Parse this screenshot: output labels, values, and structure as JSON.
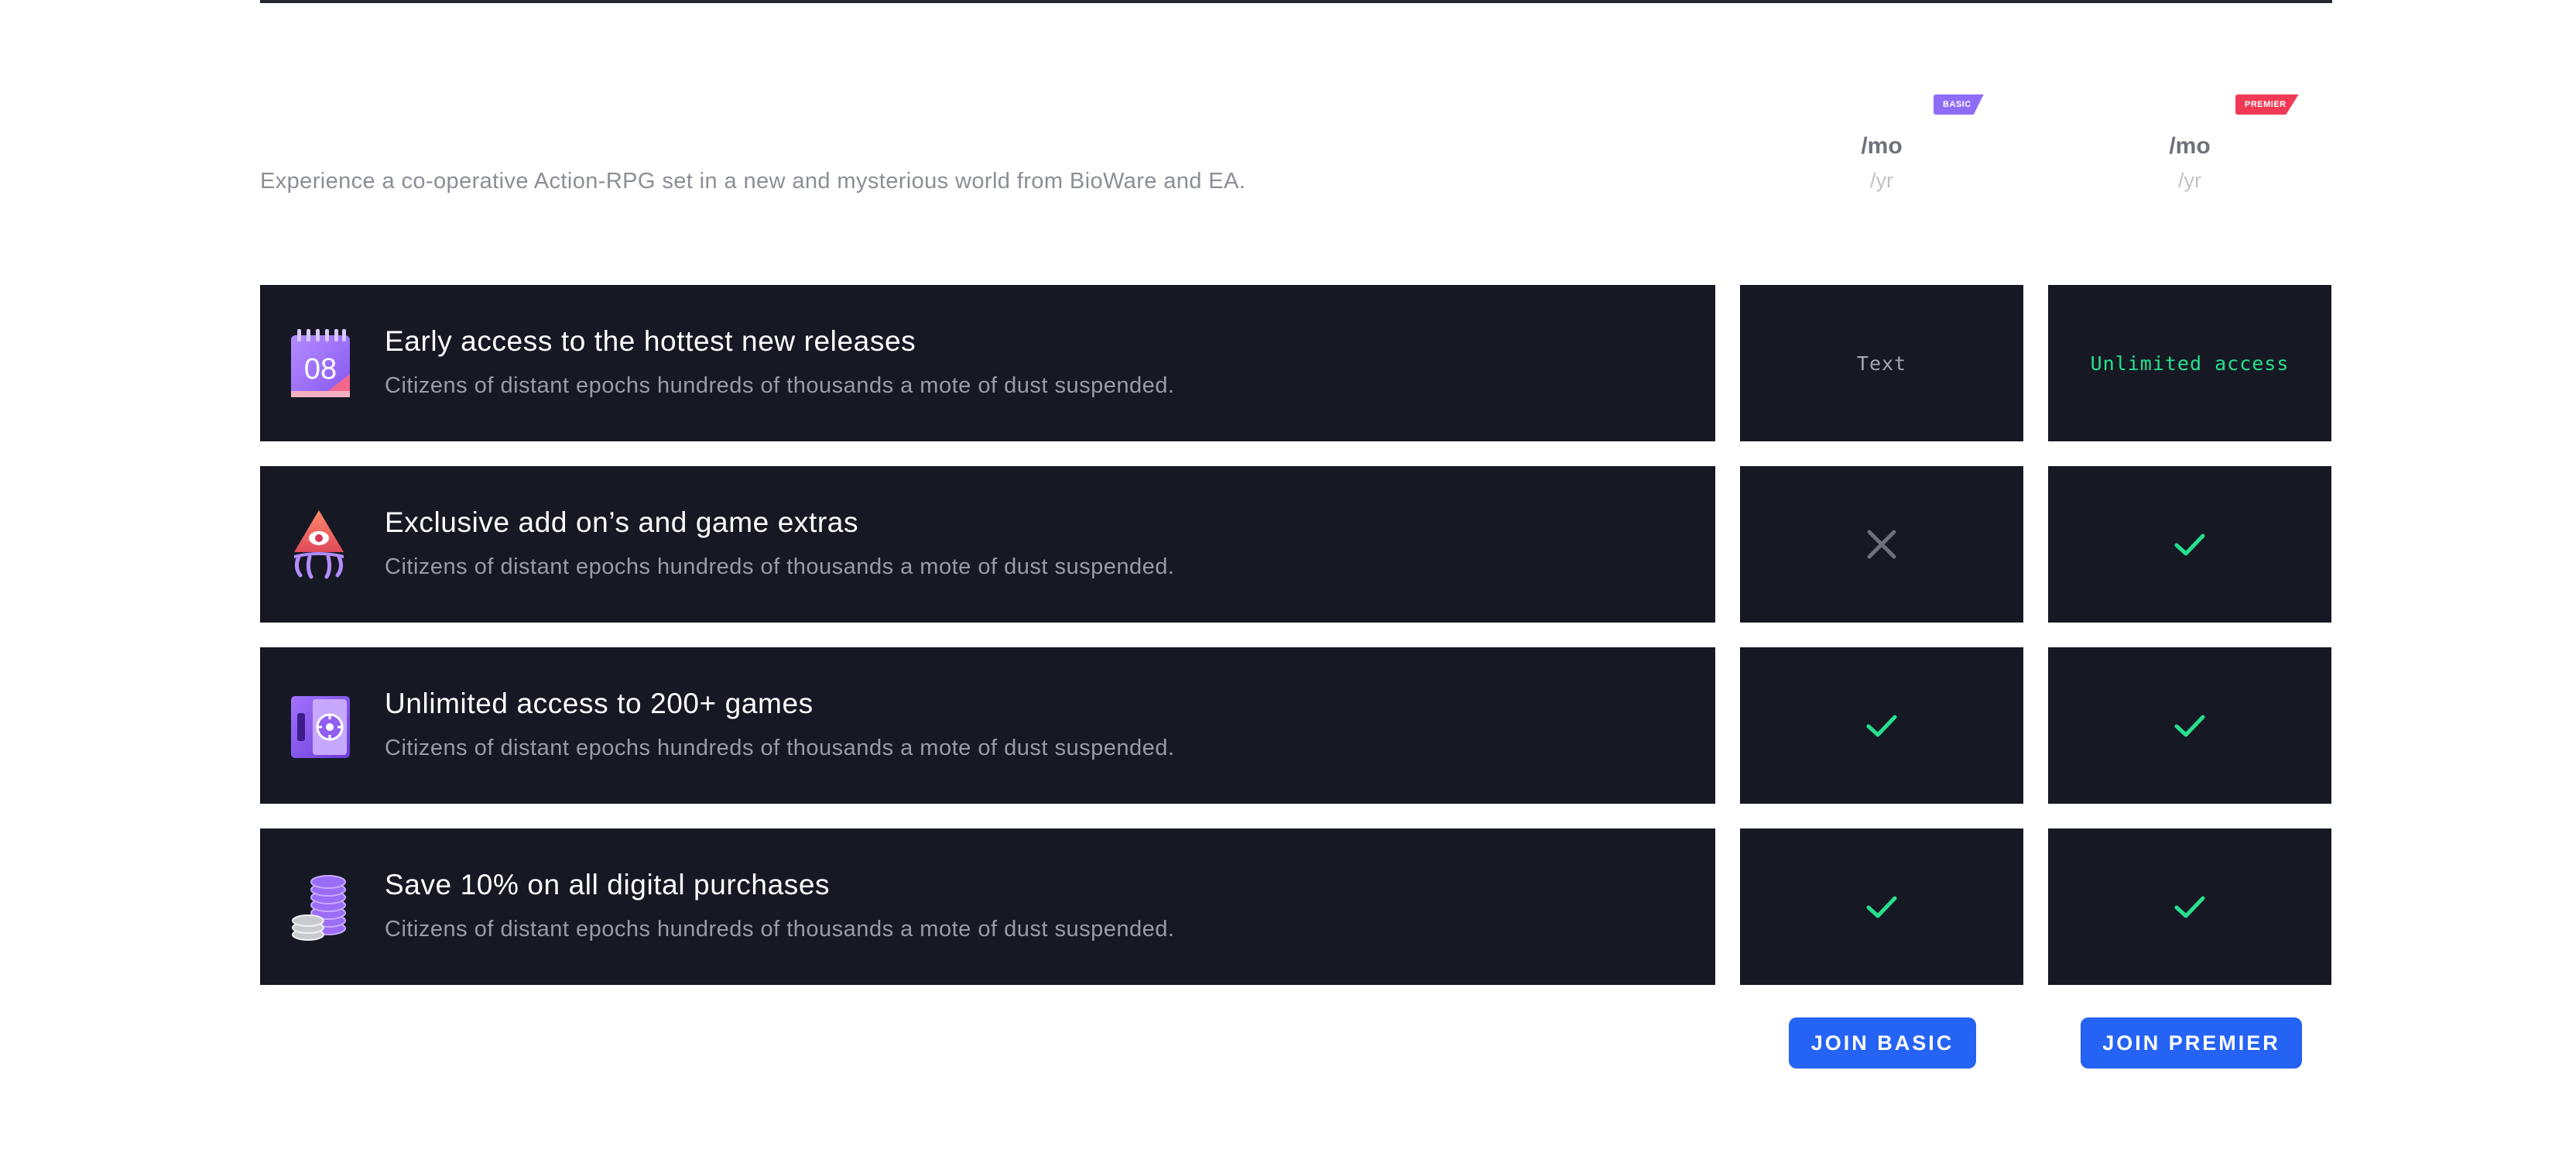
{
  "header": {
    "description": "Experience a co-operative Action-RPG set in a new and mysterious world from BioWare and EA."
  },
  "plans": [
    {
      "badge": "BASIC",
      "badge_color": "#8f6cf7",
      "price_mo": "/mo",
      "price_yr": "/yr",
      "button_label": "JOIN BASIC"
    },
    {
      "badge": "PREMIER",
      "badge_color": "#f03a55",
      "price_mo": "/mo",
      "price_yr": "/yr",
      "button_label": "JOIN PREMIER"
    }
  ],
  "features": [
    {
      "icon": "calendar-icon",
      "icon_text": "08",
      "title": "Early access to the hottest new releases",
      "description": "Citizens of distant epochs hundreds of thousands a mote of dust suspended.",
      "basic": {
        "type": "text",
        "value": "Text"
      },
      "premier": {
        "type": "text",
        "value": "Unlimited access"
      }
    },
    {
      "icon": "pyramid-eye-icon",
      "title": "Exclusive add on’s and game extras",
      "description": "Citizens of distant epochs hundreds of thousands a mote of dust suspended.",
      "basic": {
        "type": "cross"
      },
      "premier": {
        "type": "check"
      }
    },
    {
      "icon": "vault-icon",
      "title": "Unlimited access to 200+ games",
      "description": "Citizens of distant epochs hundreds of thousands a mote of dust suspended.",
      "basic": {
        "type": "check"
      },
      "premier": {
        "type": "check"
      }
    },
    {
      "icon": "coin-stack-icon",
      "title": "Save 10% on all digital purchases",
      "description": "Citizens of distant epochs hundreds of thousands a mote of dust suspended.",
      "basic": {
        "type": "check"
      },
      "premier": {
        "type": "check"
      }
    }
  ],
  "colors": {
    "row_background": "#161924",
    "check": "#27e08e",
    "cross": "#6e717a",
    "button": "#2563f5"
  }
}
